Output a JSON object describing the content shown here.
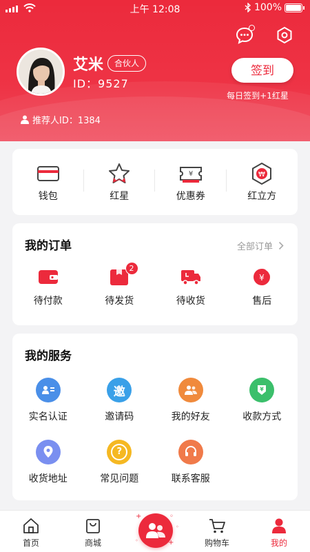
{
  "status_bar": {
    "time": "上午 12:08",
    "battery": "100%"
  },
  "profile": {
    "name": "艾米",
    "role": "合伙人",
    "id_text": "ID：9527",
    "checkin_label": "签到",
    "checkin_note": "每日签到+1红星",
    "referrer_text": "推荐人ID：1384"
  },
  "wallet_row": [
    {
      "label": "钱包",
      "icon": "wallet-icon"
    },
    {
      "label": "红星",
      "icon": "star-icon"
    },
    {
      "label": "优惠券",
      "icon": "coupon-icon"
    },
    {
      "label": "红立方",
      "icon": "cube-icon"
    }
  ],
  "orders": {
    "title": "我的订单",
    "all_label": "全部订单",
    "items": [
      {
        "label": "待付款",
        "icon": "wallet-pay-icon",
        "badge": ""
      },
      {
        "label": "待发货",
        "icon": "package-icon",
        "badge": "2"
      },
      {
        "label": "待收货",
        "icon": "truck-icon",
        "badge": ""
      },
      {
        "label": "售后",
        "icon": "after-sales-icon",
        "badge": ""
      }
    ]
  },
  "services": {
    "title": "我的服务",
    "items": [
      {
        "label": "实名认证",
        "icon": "id-card-icon",
        "color": "#4a8fe8"
      },
      {
        "label": "邀请码",
        "icon": "invite-icon",
        "color": "#3aa0e8",
        "glyph": "邀"
      },
      {
        "label": "我的好友",
        "icon": "friends-icon",
        "color": "#f08a3c"
      },
      {
        "label": "收款方式",
        "icon": "payment-method-icon",
        "color": "#3bbf6b"
      },
      {
        "label": "收货地址",
        "icon": "location-icon",
        "color": "#7a8ff0"
      },
      {
        "label": "常见问题",
        "icon": "question-icon",
        "color": "#f5b822",
        "glyph": "?"
      },
      {
        "label": "联系客服",
        "icon": "headset-icon",
        "color": "#f07a4a"
      }
    ]
  },
  "tabbar": [
    {
      "label": "首页",
      "icon": "home-icon",
      "active": false
    },
    {
      "label": "商城",
      "icon": "shop-bag-icon",
      "active": false
    },
    {
      "label": "",
      "icon": "friends-center-icon",
      "active": false
    },
    {
      "label": "购物车",
      "icon": "cart-icon",
      "active": false
    },
    {
      "label": "我的",
      "icon": "user-icon",
      "active": true
    }
  ],
  "colors": {
    "brand": "#ec2a3c"
  }
}
